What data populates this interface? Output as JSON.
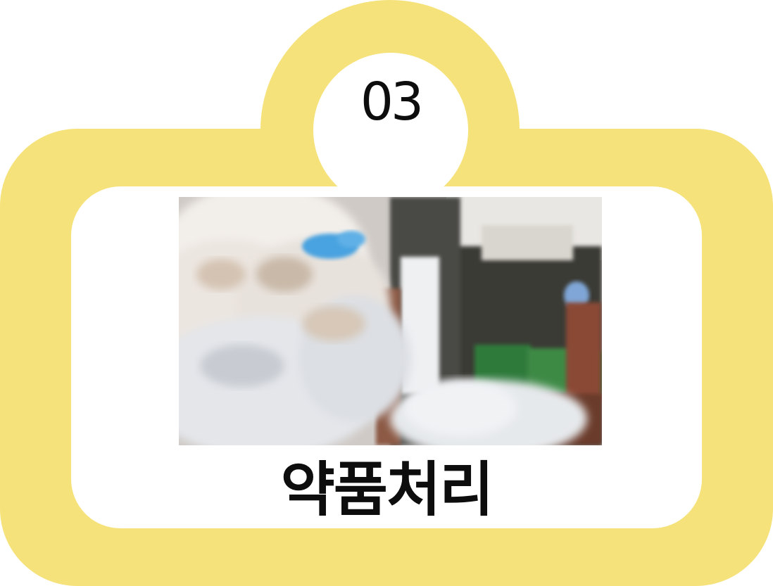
{
  "step": {
    "number": "03",
    "title": "약품처리"
  },
  "colors": {
    "frame": "#f6e27a",
    "panel": "#ffffff",
    "text": "#0d0d0d"
  },
  "photo": {
    "subject": "cotton-bales-photo"
  }
}
